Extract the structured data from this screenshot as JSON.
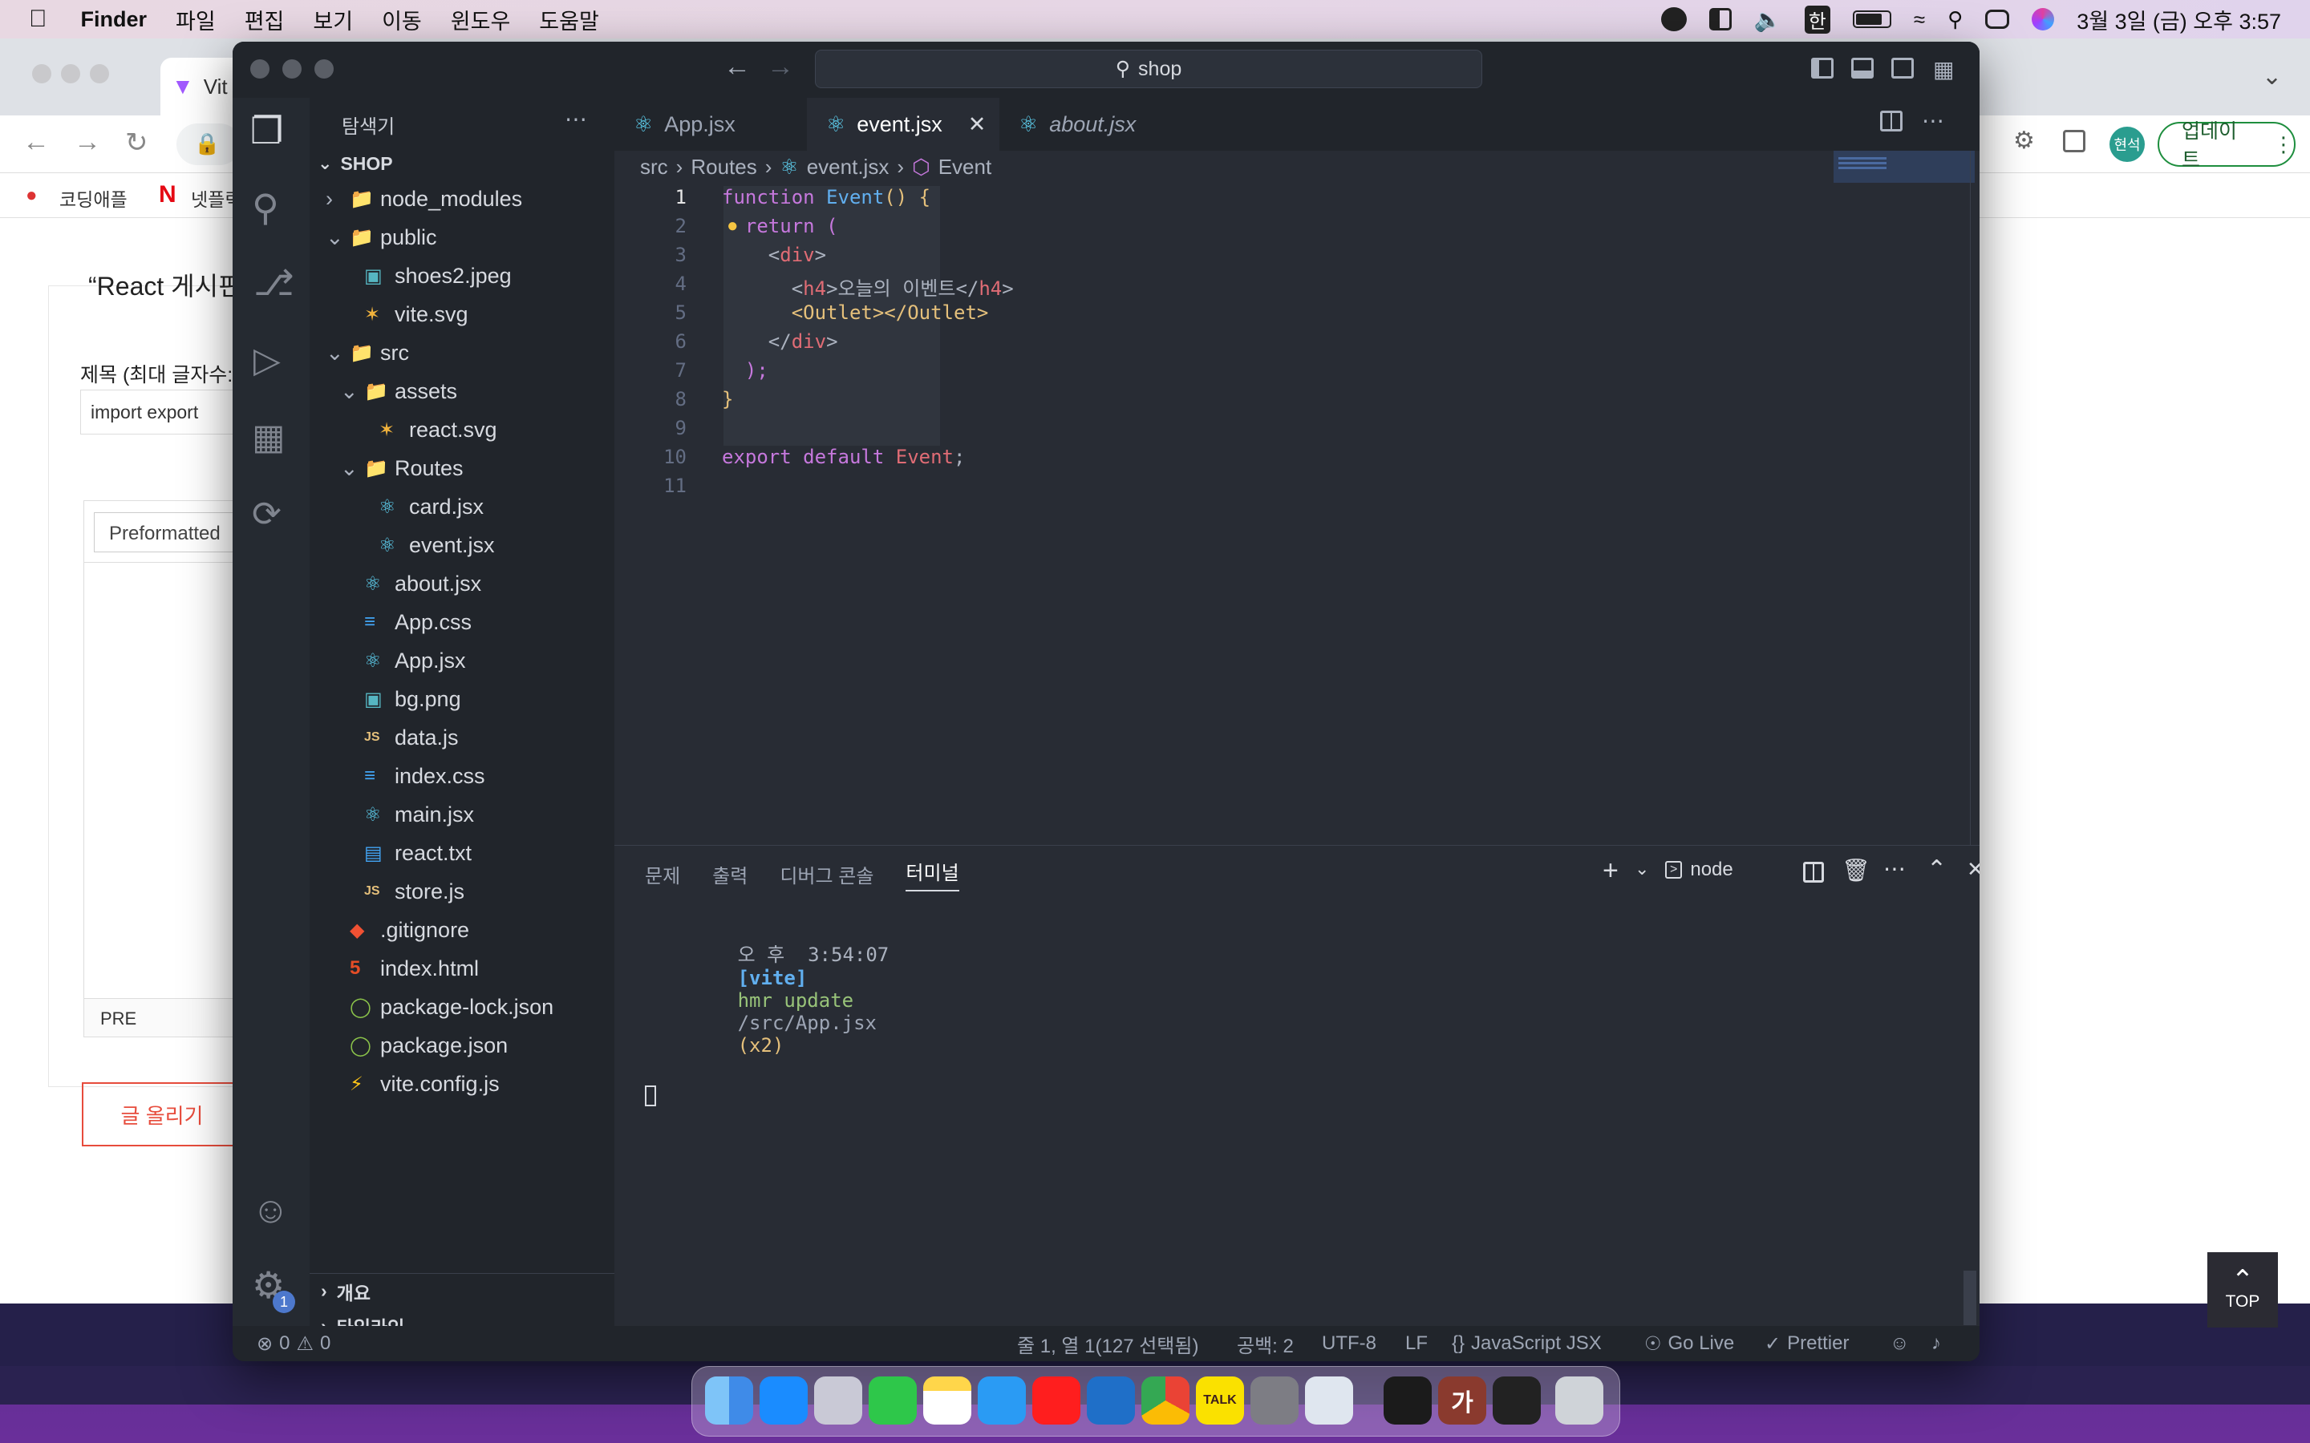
{
  "menubar": {
    "apple_icon": "apple-icon",
    "items": [
      "Finder",
      "파일",
      "편집",
      "보기",
      "이동",
      "윈도우",
      "도움말"
    ],
    "clock": "3월 3일 (금) 오후 3:57",
    "ime": "한"
  },
  "browser": {
    "tab_title": "Vit",
    "bookmarks": [
      "코딩애플",
      "넷플릭"
    ],
    "profile": "현석",
    "update_button": "업데이트",
    "page": {
      "heading": "“React 게시핀",
      "title_label": "제목 (최대 글자수:",
      "title_value": "import export",
      "format_select": "Preformatted",
      "path_label": "PRE",
      "submit": "글 올리기",
      "top_button": "TOP"
    }
  },
  "vscode": {
    "search_box": "shop",
    "sidebar": {
      "title": "탐색기",
      "root": "SHOP",
      "tree": [
        {
          "label": "node_modules",
          "depth": 1,
          "kind": "folder",
          "open": false
        },
        {
          "label": "public",
          "depth": 1,
          "kind": "folder",
          "open": true
        },
        {
          "label": "shoes2.jpeg",
          "depth": 2,
          "kind": "image"
        },
        {
          "label": "vite.svg",
          "depth": 2,
          "kind": "svg"
        },
        {
          "label": "src",
          "depth": 1,
          "kind": "folder",
          "open": true
        },
        {
          "label": "assets",
          "depth": 2,
          "kind": "folder",
          "open": true
        },
        {
          "label": "react.svg",
          "depth": 3,
          "kind": "svg"
        },
        {
          "label": "Routes",
          "depth": 2,
          "kind": "folder",
          "open": true
        },
        {
          "label": "card.jsx",
          "depth": 3,
          "kind": "react"
        },
        {
          "label": "event.jsx",
          "depth": 3,
          "kind": "react"
        },
        {
          "label": "about.jsx",
          "depth": 2,
          "kind": "react"
        },
        {
          "label": "App.css",
          "depth": 2,
          "kind": "css"
        },
        {
          "label": "App.jsx",
          "depth": 2,
          "kind": "react"
        },
        {
          "label": "bg.png",
          "depth": 2,
          "kind": "image"
        },
        {
          "label": "data.js",
          "depth": 2,
          "kind": "js"
        },
        {
          "label": "index.css",
          "depth": 2,
          "kind": "css"
        },
        {
          "label": "main.jsx",
          "depth": 2,
          "kind": "react"
        },
        {
          "label": "react.txt",
          "depth": 2,
          "kind": "txt"
        },
        {
          "label": "store.js",
          "depth": 2,
          "kind": "js"
        },
        {
          "label": ".gitignore",
          "depth": 1,
          "kind": "git"
        },
        {
          "label": "index.html",
          "depth": 1,
          "kind": "html"
        },
        {
          "label": "package-lock.json",
          "depth": 1,
          "kind": "json"
        },
        {
          "label": "package.json",
          "depth": 1,
          "kind": "json"
        },
        {
          "label": "vite.config.js",
          "depth": 1,
          "kind": "vite"
        }
      ],
      "outline": "개요",
      "timeline": "타임라인"
    },
    "tabs": [
      {
        "label": "App.jsx",
        "active": false,
        "italic": false
      },
      {
        "label": "event.jsx",
        "active": true,
        "italic": false
      },
      {
        "label": "about.jsx",
        "active": false,
        "italic": true
      }
    ],
    "breadcrumb": [
      "src",
      "Routes",
      "event.jsx",
      "Event"
    ],
    "code": [
      [
        {
          "t": "function ",
          "c": "kw"
        },
        {
          "t": "Event",
          "c": "fn"
        },
        {
          "t": "() {",
          "c": "br"
        }
      ],
      [
        {
          "t": "  ",
          "c": "pl"
        },
        {
          "t": "return ",
          "c": "kw"
        },
        {
          "t": "(",
          "c": "br2"
        }
      ],
      [
        {
          "t": "    ",
          "c": "pl"
        },
        {
          "t": "<",
          "c": "pl"
        },
        {
          "t": "div",
          "c": "tg"
        },
        {
          "t": ">",
          "c": "pl"
        }
      ],
      [
        {
          "t": "      ",
          "c": "pl"
        },
        {
          "t": "<",
          "c": "pl"
        },
        {
          "t": "h4",
          "c": "tg"
        },
        {
          "t": ">오늘의 이벤트</",
          "c": "pl"
        },
        {
          "t": "h4",
          "c": "tg"
        },
        {
          "t": ">",
          "c": "pl"
        }
      ],
      [
        {
          "t": "      ",
          "c": "pl"
        },
        {
          "t": "<Outlet></Outlet>",
          "c": "br"
        }
      ],
      [
        {
          "t": "    ",
          "c": "pl"
        },
        {
          "t": "</",
          "c": "pl"
        },
        {
          "t": "div",
          "c": "tg"
        },
        {
          "t": ">",
          "c": "pl"
        }
      ],
      [
        {
          "t": "  ",
          "c": "pl"
        },
        {
          "t": ");",
          "c": "br2"
        }
      ],
      [
        {
          "t": "}",
          "c": "br"
        }
      ],
      [
        {
          "t": "",
          "c": "pl"
        }
      ],
      [
        {
          "t": "export default ",
          "c": "kw"
        },
        {
          "t": "Event",
          "c": "tg"
        },
        {
          "t": ";",
          "c": "pl"
        }
      ],
      [
        {
          "t": "",
          "c": "pl"
        }
      ]
    ],
    "panel": {
      "tabs": [
        "문제",
        "출력",
        "디버그 콘솔",
        "터미널"
      ],
      "active_tab": "터미널",
      "shell": "node",
      "terminal": {
        "time": "오 후  3:54:07",
        "tag": "[vite]",
        "msg": "hmr update",
        "path": "/src/App.jsx",
        "count": "(x2)"
      }
    },
    "status": {
      "errors": "0",
      "warnings": "0",
      "position": "줄 1, 열 1(127 선택됨)",
      "spaces": "공백: 2",
      "encoding": "UTF-8",
      "eol": "LF",
      "language": "JavaScript JSX",
      "golive": "Go Live",
      "prettier": "Prettier",
      "settings_badge": "1"
    }
  },
  "dock": {
    "apps": [
      "finder-icon",
      "app-store-icon",
      "launchpad-icon",
      "facetime-icon",
      "notes-icon",
      "safari-icon",
      "youtube-music-icon",
      "vscode-icon",
      "chrome-icon",
      "kakaotalk-icon",
      "system-settings-icon",
      "preview-icon",
      "terminal-icon",
      "dictionary-icon",
      "screen-recorder-icon",
      "trash-icon"
    ],
    "kakao_label": "TALK",
    "dict_label": "가"
  },
  "colors": {
    "accent": "#61afef",
    "keyword": "#c678dd",
    "tag": "#e06c75",
    "gold": "#e5c07b",
    "submit": "#e74c3c"
  }
}
